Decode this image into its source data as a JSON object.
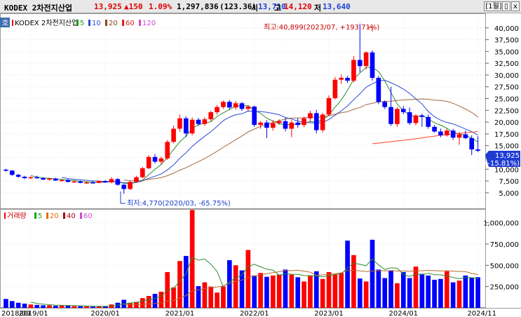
{
  "header": {
    "name": "KODEX 2차전지산업",
    "price": "13,925",
    "change": "▲150",
    "change_pct": "1.09%",
    "volume": "1,297,836",
    "volume_change": "(123.36)",
    "open_label": "시",
    "open": "13,710",
    "high_label": "고",
    "high": "14,120",
    "low_label": "저",
    "low": "13,640",
    "period_button": "[1월]",
    "settings_button": "▯",
    "close_button": "x"
  },
  "price_panel": {
    "tab_label": "호",
    "legend_name": "KODEX 2차전지산업",
    "ma_legend": [
      {
        "label": "5",
        "color": "#1a9e1a"
      },
      {
        "label": "10",
        "color": "#2b4ad6"
      },
      {
        "label": "20",
        "color": "#8b4513"
      },
      {
        "label": "60",
        "color": "#d4231a"
      },
      {
        "label": "120",
        "color": "#d04ad0"
      }
    ],
    "max_annotation": "최고:40,899(2023/07, +193.71%)",
    "min_annotation": "최저:4,770(2020/03, -65.75%)",
    "current_tag": "13,925",
    "current_tag_pct": "(-15.81%)"
  },
  "volume_panel": {
    "legend_name": "거래량",
    "ma_legend": [
      {
        "label": "5",
        "color": "#1a9e1a"
      },
      {
        "label": "20",
        "color": "#e66d00"
      },
      {
        "label": "40",
        "color": "#b0000a"
      },
      {
        "label": "60",
        "color": "#d04ad0"
      }
    ]
  },
  "colors": {
    "up": "#ff0000",
    "down": "#0000ff",
    "ma5": "#2e8b2e",
    "ma10": "#2b4ad6",
    "ma20": "#8b4513",
    "long_ma": "#ff4422"
  },
  "chart_data": [
    {
      "type": "candlestick",
      "interval": "monthly",
      "y_ticks": [
        5000,
        7500,
        10000,
        12500,
        15000,
        17500,
        20000,
        22500,
        25000,
        27500,
        30000,
        32500,
        35000,
        37500,
        40000
      ],
      "y_tick_labels": [
        "5,000",
        "7,500",
        "10,000",
        "12,500",
        "15,000",
        "17,500",
        "20,000",
        "22,500",
        "25,000",
        "27,500",
        "30,000",
        "32,500",
        "35,000",
        "37,500",
        "40,000"
      ],
      "ylim": [
        2000,
        42500
      ],
      "candles": [
        {
          "o": 9900,
          "h": 10100,
          "l": 9500,
          "c": 9700
        },
        {
          "o": 9700,
          "h": 9800,
          "l": 8600,
          "c": 8800
        },
        {
          "o": 8800,
          "h": 9000,
          "l": 8200,
          "c": 8400
        },
        {
          "o": 8400,
          "h": 8600,
          "l": 7900,
          "c": 8100
        },
        {
          "o": 8100,
          "h": 8500,
          "l": 7900,
          "c": 8300
        },
        {
          "o": 8300,
          "h": 8600,
          "l": 8000,
          "c": 8100
        },
        {
          "o": 8100,
          "h": 8300,
          "l": 7700,
          "c": 7800
        },
        {
          "o": 7800,
          "h": 8200,
          "l": 7600,
          "c": 8000
        },
        {
          "o": 8000,
          "h": 8200,
          "l": 7500,
          "c": 7600
        },
        {
          "o": 7600,
          "h": 7900,
          "l": 7400,
          "c": 7700
        },
        {
          "o": 7700,
          "h": 7900,
          "l": 7200,
          "c": 7300
        },
        {
          "o": 7300,
          "h": 7600,
          "l": 7100,
          "c": 7400
        },
        {
          "o": 7400,
          "h": 7600,
          "l": 7000,
          "c": 7100
        },
        {
          "o": 7100,
          "h": 7400,
          "l": 6900,
          "c": 7200
        },
        {
          "o": 7200,
          "h": 7500,
          "l": 7000,
          "c": 7100
        },
        {
          "o": 7100,
          "h": 7600,
          "l": 7000,
          "c": 7500
        },
        {
          "o": 7500,
          "h": 7700,
          "l": 7100,
          "c": 7200
        },
        {
          "o": 7200,
          "h": 8300,
          "l": 7000,
          "c": 7900
        },
        {
          "o": 7900,
          "h": 8100,
          "l": 6500,
          "c": 6700
        },
        {
          "o": 6700,
          "h": 6900,
          "l": 4770,
          "c": 5800
        },
        {
          "o": 5800,
          "h": 7600,
          "l": 5600,
          "c": 7300
        },
        {
          "o": 7300,
          "h": 8600,
          "l": 7100,
          "c": 8300
        },
        {
          "o": 8300,
          "h": 10500,
          "l": 8100,
          "c": 10200
        },
        {
          "o": 10200,
          "h": 13000,
          "l": 10000,
          "c": 12600
        },
        {
          "o": 12600,
          "h": 13200,
          "l": 11200,
          "c": 11600
        },
        {
          "o": 11600,
          "h": 12700,
          "l": 11000,
          "c": 12300
        },
        {
          "o": 12300,
          "h": 16200,
          "l": 12000,
          "c": 15800
        },
        {
          "o": 15800,
          "h": 19300,
          "l": 15500,
          "c": 18600
        },
        {
          "o": 18600,
          "h": 21600,
          "l": 18000,
          "c": 20800
        },
        {
          "o": 20800,
          "h": 21200,
          "l": 16800,
          "c": 17600
        },
        {
          "o": 17600,
          "h": 21000,
          "l": 17200,
          "c": 20500
        },
        {
          "o": 20500,
          "h": 20900,
          "l": 19200,
          "c": 19600
        },
        {
          "o": 19600,
          "h": 21000,
          "l": 19200,
          "c": 20600
        },
        {
          "o": 20600,
          "h": 22400,
          "l": 20200,
          "c": 22100
        },
        {
          "o": 22100,
          "h": 23600,
          "l": 21600,
          "c": 23200
        },
        {
          "o": 23200,
          "h": 24600,
          "l": 22800,
          "c": 24300
        },
        {
          "o": 24300,
          "h": 24700,
          "l": 22700,
          "c": 23100
        },
        {
          "o": 23100,
          "h": 24500,
          "l": 22600,
          "c": 24000
        },
        {
          "o": 24000,
          "h": 24300,
          "l": 22400,
          "c": 22800
        },
        {
          "o": 22800,
          "h": 23600,
          "l": 22200,
          "c": 23300
        },
        {
          "o": 23300,
          "h": 23500,
          "l": 19000,
          "c": 19400
        },
        {
          "o": 19400,
          "h": 20200,
          "l": 18600,
          "c": 19900
        },
        {
          "o": 19900,
          "h": 20400,
          "l": 16600,
          "c": 18800
        },
        {
          "o": 18800,
          "h": 20400,
          "l": 18200,
          "c": 19800
        },
        {
          "o": 19800,
          "h": 20600,
          "l": 19400,
          "c": 20200
        },
        {
          "o": 20200,
          "h": 20900,
          "l": 18000,
          "c": 18600
        },
        {
          "o": 18600,
          "h": 20400,
          "l": 16800,
          "c": 19900
        },
        {
          "o": 19900,
          "h": 20800,
          "l": 18800,
          "c": 19400
        },
        {
          "o": 19400,
          "h": 21200,
          "l": 18900,
          "c": 20800
        },
        {
          "o": 20800,
          "h": 22400,
          "l": 20200,
          "c": 21900
        },
        {
          "o": 21900,
          "h": 22600,
          "l": 17600,
          "c": 18300
        },
        {
          "o": 18300,
          "h": 22000,
          "l": 17800,
          "c": 21600
        },
        {
          "o": 21600,
          "h": 25700,
          "l": 21300,
          "c": 25100
        },
        {
          "o": 25100,
          "h": 29600,
          "l": 24800,
          "c": 29000
        },
        {
          "o": 29000,
          "h": 30100,
          "l": 28100,
          "c": 29400
        },
        {
          "o": 29400,
          "h": 29800,
          "l": 28300,
          "c": 28800
        },
        {
          "o": 28800,
          "h": 34000,
          "l": 28400,
          "c": 33200
        },
        {
          "o": 33200,
          "h": 40899,
          "l": 30600,
          "c": 31900
        },
        {
          "o": 31900,
          "h": 35000,
          "l": 31200,
          "c": 34800
        },
        {
          "o": 34800,
          "h": 35200,
          "l": 28800,
          "c": 29400
        },
        {
          "o": 29400,
          "h": 29800,
          "l": 23800,
          "c": 24300
        },
        {
          "o": 24300,
          "h": 24600,
          "l": 22800,
          "c": 23200
        },
        {
          "o": 23200,
          "h": 27500,
          "l": 19200,
          "c": 19600
        },
        {
          "o": 19600,
          "h": 23200,
          "l": 19000,
          "c": 22800
        },
        {
          "o": 22800,
          "h": 23400,
          "l": 21700,
          "c": 22100
        },
        {
          "o": 22100,
          "h": 23100,
          "l": 19400,
          "c": 19800
        },
        {
          "o": 19800,
          "h": 21700,
          "l": 19300,
          "c": 21400
        },
        {
          "o": 21400,
          "h": 21800,
          "l": 19000,
          "c": 21100
        },
        {
          "o": 21100,
          "h": 21600,
          "l": 18600,
          "c": 19000
        },
        {
          "o": 19000,
          "h": 19400,
          "l": 17800,
          "c": 18000
        },
        {
          "o": 18000,
          "h": 18600,
          "l": 16800,
          "c": 17200
        },
        {
          "o": 17200,
          "h": 18600,
          "l": 16900,
          "c": 18200
        },
        {
          "o": 18200,
          "h": 18500,
          "l": 16200,
          "c": 16700
        },
        {
          "o": 16700,
          "h": 17900,
          "l": 15200,
          "c": 17400
        },
        {
          "o": 17400,
          "h": 18200,
          "l": 16400,
          "c": 16600
        },
        {
          "o": 16600,
          "h": 17200,
          "l": 13000,
          "c": 14200
        },
        {
          "o": 14200,
          "h": 17000,
          "l": 13640,
          "c": 13925
        }
      ],
      "long_ma_line": [
        {
          "i": 59,
          "v": 15400
        },
        {
          "i": 65,
          "v": 16300
        },
        {
          "i": 70,
          "v": 17200
        },
        {
          "i": 76,
          "v": 18000
        }
      ],
      "x_tick_labels": [
        "2018/09",
        "2019/01",
        "2020/01",
        "2021/01",
        "2022/01",
        "2023/01",
        "2024/01",
        "2024/11"
      ],
      "x_tick_index": [
        0,
        4,
        16,
        28,
        40,
        52,
        64,
        76
      ]
    },
    {
      "type": "bar",
      "series_name": "거래량",
      "y_ticks": [
        250000,
        500000,
        750000,
        1000000
      ],
      "y_tick_labels": [
        "250,000",
        "500,000",
        "750,000",
        "1,000,000"
      ],
      "ylim": [
        0,
        1120000
      ],
      "values": [
        105000,
        80000,
        60000,
        50000,
        40000,
        35000,
        30000,
        30000,
        25000,
        30000,
        25000,
        20000,
        20000,
        18000,
        15000,
        18000,
        20000,
        40000,
        60000,
        95000,
        60000,
        70000,
        115000,
        140000,
        165000,
        190000,
        420000,
        240000,
        550000,
        610000,
        1150000,
        255000,
        300000,
        250000,
        180000,
        250000,
        560000,
        500000,
        440000,
        680000,
        380000,
        410000,
        365000,
        380000,
        390000,
        450000,
        390000,
        360000,
        310000,
        380000,
        430000,
        340000,
        420000,
        390000,
        410000,
        790000,
        620000,
        345000,
        310000,
        800000,
        450000,
        350000,
        440000,
        290000,
        420000,
        350000,
        485000,
        400000,
        380000,
        330000,
        340000,
        430000,
        300000,
        320000,
        380000,
        350000,
        360000
      ]
    }
  ]
}
